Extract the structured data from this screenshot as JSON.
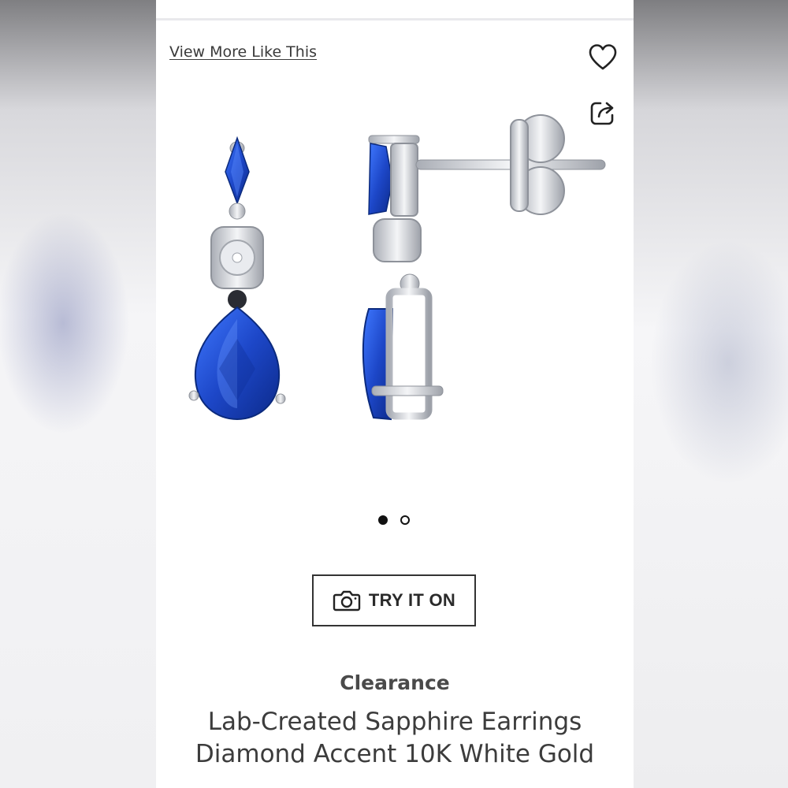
{
  "links": {
    "view_more": "View More Like This"
  },
  "icons": {
    "favorite": "heart-outline-icon",
    "share": "share-icon",
    "camera": "camera-icon"
  },
  "carousel": {
    "total": 2,
    "active_index": 0
  },
  "try_on": {
    "label": "TRY IT ON"
  },
  "product": {
    "badge": "Clearance",
    "title_line1": "Lab-Created Sapphire Earrings",
    "title_line2": "Diamond Accent 10K White Gold"
  },
  "colors": {
    "sapphire": "#1f4fd0",
    "text": "#3c3c3c",
    "metal": "#d7d9de"
  }
}
